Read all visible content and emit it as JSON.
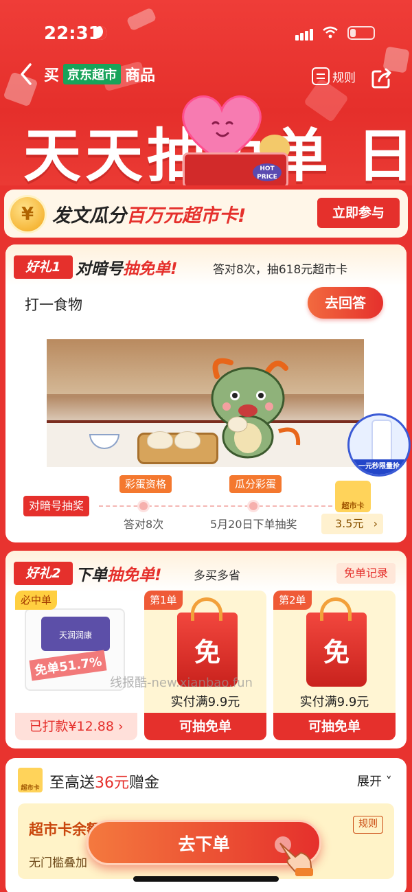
{
  "status": {
    "time": "22:31"
  },
  "nav": {
    "prefix": "买",
    "store": "京东超市",
    "suffix": "商品",
    "rule_label": "规则"
  },
  "hero": {
    "title": "天天抽免单 日",
    "hot_label": "HOT PRICE"
  },
  "banner": {
    "coin": "¥",
    "text_a": "发文瓜分",
    "text_hl": "百万元超市卡!",
    "join_label": "立即参与"
  },
  "gift1": {
    "tag": "好礼1",
    "title_a": "对暗号",
    "title_hl": "抽免单!",
    "subtitle": "答对8次，抽618元超市卡",
    "riddle": "打一食物",
    "answer_label": "去回答",
    "promo_label": "一元秒限量抢",
    "timeline": {
      "start": "对暗号抽奖",
      "step1_bubble": "彩蛋资格",
      "step1_label": "答对8次",
      "step2_bubble": "瓜分彩蛋",
      "step2_label": "5月20日下单抽奖",
      "card_label": "超市卡",
      "card_price": "3.5元",
      "card_arrow": "›"
    }
  },
  "gift2": {
    "tag": "好礼2",
    "title_a": "下单",
    "title_hl": "抽免单!",
    "subtitle": "多买多省",
    "record_label": "免单记录",
    "products": [
      {
        "badge": "必中单",
        "lid_text": "天润润康",
        "discount": "免单51.7%",
        "foot": "已打款¥12.88 ›"
      },
      {
        "badge": "第1单",
        "bag_text": "免",
        "condition": "实付满9.9元",
        "foot": "可抽免单"
      },
      {
        "badge": "第2单",
        "bag_text": "免",
        "condition": "实付满9.9元",
        "foot": "可抽免单"
      }
    ]
  },
  "watermark": "线报酷-new.xianbao.fun",
  "gold": {
    "icon_label": "超市卡",
    "title_a": "至高送",
    "title_hl": "36元",
    "title_b": "赠金",
    "expand_label": "展开 ˅",
    "balance_label": "超市卡余额",
    "rule_label": "规则",
    "sub": "无门槛叠加",
    "cta_label": "去下单"
  },
  "colors": {
    "brand_red": "#e5302c",
    "jd_green": "#18a35a",
    "orange": "#f4782f"
  }
}
